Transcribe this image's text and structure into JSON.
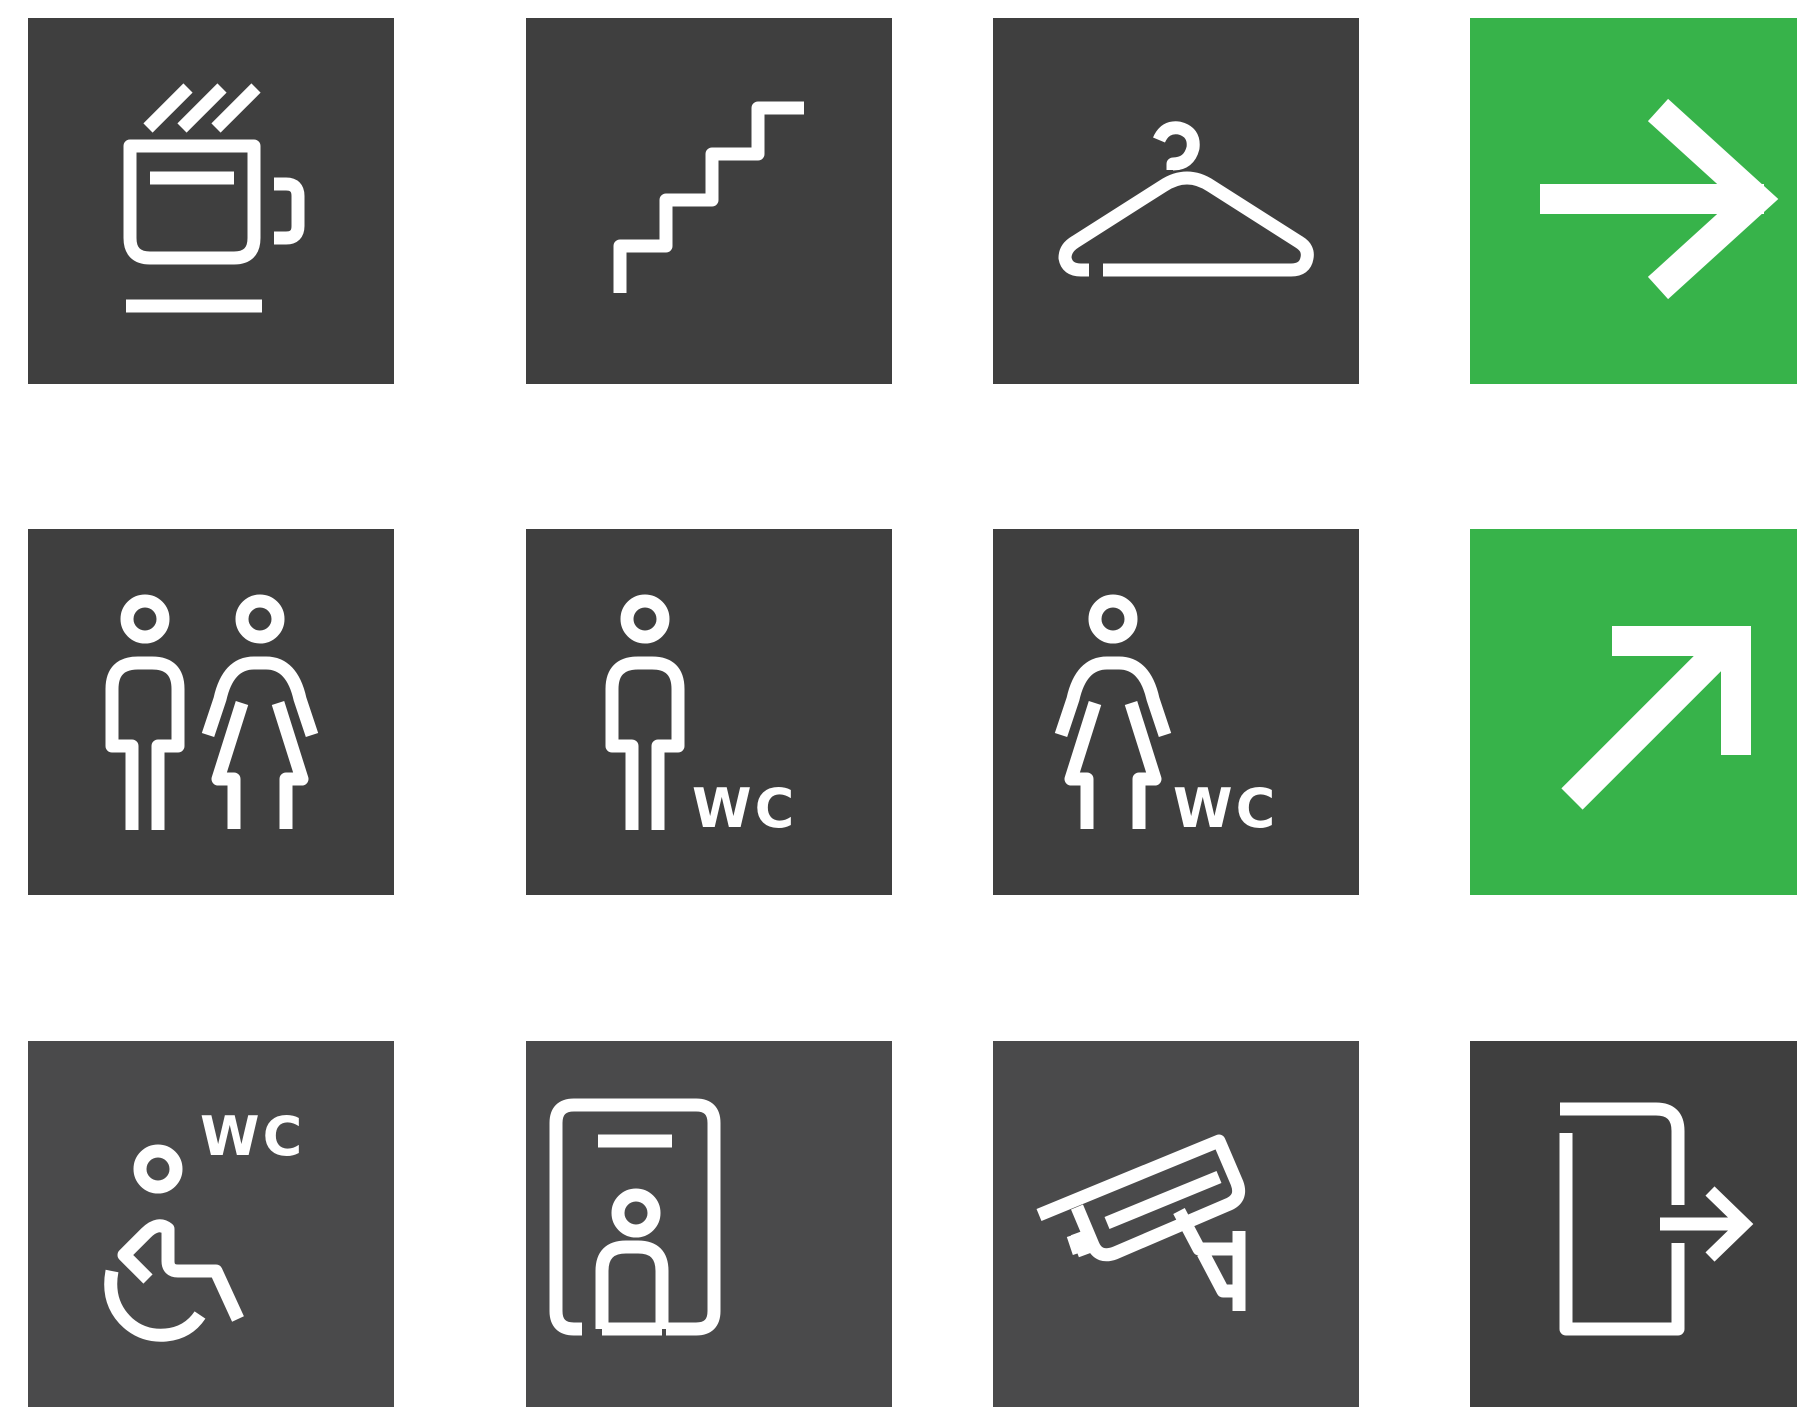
{
  "colors": {
    "tile_dark": "#3f3f3f",
    "tile_mid": "#4a4a4b",
    "tile_green": "#37b34a",
    "icon": "#ffffff"
  },
  "tiles": [
    {
      "name": "coffee",
      "icon": "coffee-mug-icon"
    },
    {
      "name": "stairs",
      "icon": "stairs-icon"
    },
    {
      "name": "cloakroom",
      "icon": "coat-hanger-icon"
    },
    {
      "name": "direction-right",
      "icon": "arrow-right-icon"
    },
    {
      "name": "restrooms",
      "icon": "man-woman-icon"
    },
    {
      "name": "mens-wc",
      "icon": "man-wc-icon",
      "label": "WC"
    },
    {
      "name": "womens-wc",
      "icon": "woman-wc-icon",
      "label": "WC"
    },
    {
      "name": "direction-up-right",
      "icon": "arrow-up-right-icon"
    },
    {
      "name": "accessible-wc",
      "icon": "wheelchair-wc-icon",
      "label": "WC"
    },
    {
      "name": "elevator",
      "icon": "elevator-person-icon"
    },
    {
      "name": "cctv",
      "icon": "security-camera-icon"
    },
    {
      "name": "exit",
      "icon": "exit-door-icon"
    }
  ]
}
